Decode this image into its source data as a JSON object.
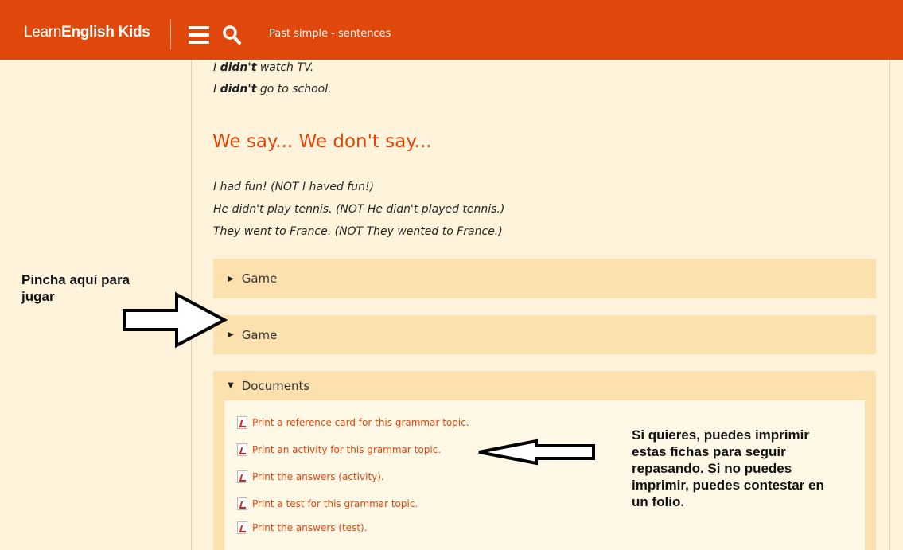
{
  "header": {
    "brand_prefix": "Learn",
    "brand_main": "English Kids",
    "page_name": "Past simple - sentences"
  },
  "examples_top": [
    {
      "before": "I ",
      "bold": "didn't",
      "after": " watch TV."
    },
    {
      "before": "I ",
      "bold": "didn't",
      "after": " go to school."
    }
  ],
  "section": {
    "title": "We say... We don't say...",
    "lines": [
      "I had fun! (NOT I haved fun!)",
      "He didn't play tennis. (NOT He didn't played tennis.)",
      "They went to France. (NOT They wented to France.)"
    ]
  },
  "accordions": [
    {
      "label": "Game",
      "state": "collapsed"
    },
    {
      "label": "Game",
      "state": "collapsed"
    },
    {
      "label": "Documents",
      "state": "expanded"
    }
  ],
  "documents": [
    "Print a reference card for this grammar topic.",
    "Print an activity for this grammar topic.",
    "Print the answers (activity).",
    "Print a test for this grammar topic.",
    "Print the answers (test)."
  ],
  "annotations": {
    "left_note_line1": "Pincha aquí para",
    "left_note_line2": "jugar",
    "right_note": [
      "Si quieres, puedes imprimir",
      "estas fichas para seguir",
      "repasando. Si no puedes",
      "imprimir, puedes contestar en",
      "un folio."
    ]
  },
  "colors": {
    "header": "#e0470a",
    "page_bg": "#fff3dc",
    "accordion_bg": "#fce0ad",
    "link": "#e0470a"
  },
  "icons": [
    "menu-icon",
    "search-icon",
    "pdf-icon",
    "triangle-right-icon",
    "triangle-down-icon",
    "arrow-right-outline",
    "arrow-left-outline"
  ]
}
